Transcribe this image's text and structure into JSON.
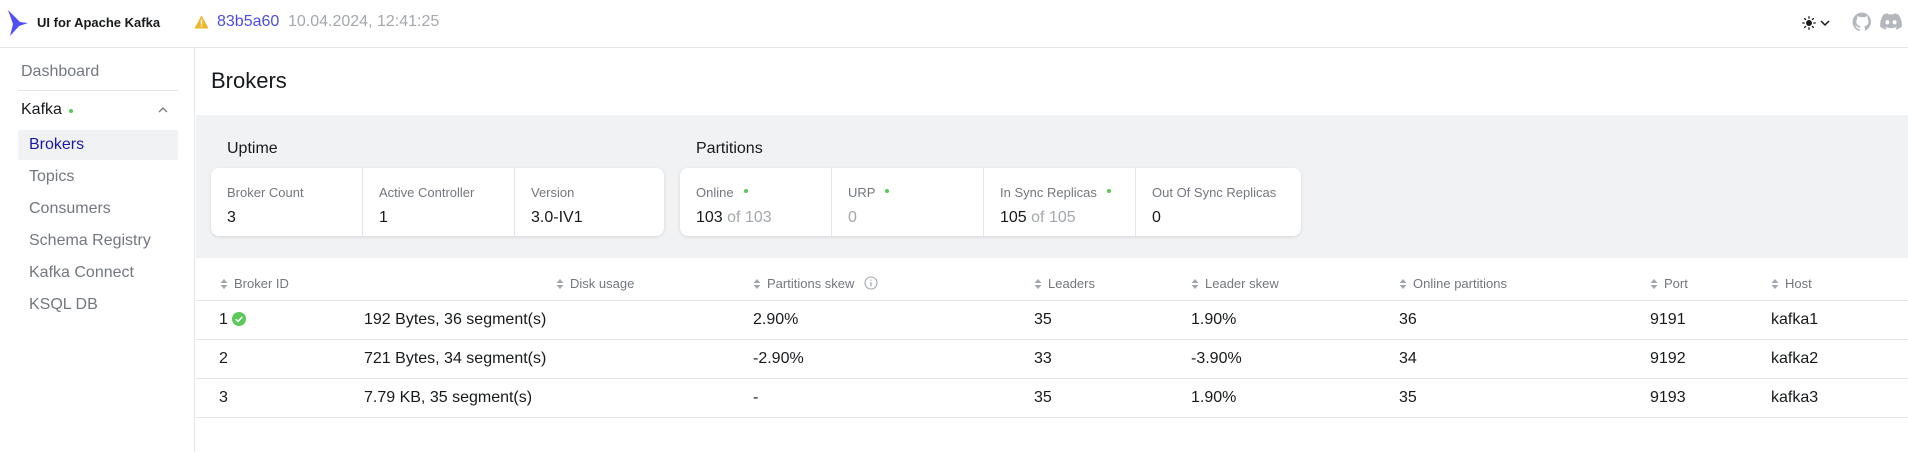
{
  "navbar": {
    "title": "UI for Apache Kafka",
    "version_hash": "83b5a60",
    "version_date": "10.04.2024, 12:41:25",
    "icons": [
      "kafka-logo",
      "warning-icon",
      "sun-icon",
      "chevron-down-icon",
      "github-icon",
      "discord-icon"
    ]
  },
  "sidebar": {
    "dashboard": "Dashboard",
    "cluster": {
      "name": "Kafka",
      "status_color": "#5ac95a"
    },
    "items": [
      {
        "label": "Brokers",
        "active": true
      },
      {
        "label": "Topics",
        "active": false
      },
      {
        "label": "Consumers",
        "active": false
      },
      {
        "label": "Schema Registry",
        "active": false
      },
      {
        "label": "Kafka Connect",
        "active": false
      },
      {
        "label": "KSQL DB",
        "active": false
      }
    ]
  },
  "page": {
    "title": "Brokers"
  },
  "uptime": {
    "label": "Uptime",
    "cards": [
      {
        "label": "Broker Count",
        "value": "3"
      },
      {
        "label": "Active Controller",
        "value": "1"
      },
      {
        "label": "Version",
        "value": "3.0-IV1"
      }
    ]
  },
  "partitions": {
    "label": "Partitions",
    "cards": [
      {
        "label": "Online",
        "value": "103",
        "of": "of 103"
      },
      {
        "label": "URP",
        "value": "0"
      },
      {
        "label": "In Sync Replicas",
        "value": "105",
        "of": "of 105"
      },
      {
        "label": "Out Of Sync Replicas",
        "value": "0"
      }
    ]
  },
  "table": {
    "columns": [
      "Broker ID",
      "Disk usage",
      "Partitions skew",
      "Leaders",
      "Leader skew",
      "Online partitions",
      "Port",
      "Host"
    ],
    "rows": [
      {
        "broker_id": "1",
        "disk_usage": "192 Bytes, 36 segment(s)",
        "partitions_skew": "2.90%",
        "leaders": "35",
        "leader_skew": "1.90%",
        "online_partitions": "36",
        "port": "9191",
        "host": "kafka1"
      },
      {
        "broker_id": "2",
        "disk_usage": "721 Bytes, 34 segment(s)",
        "partitions_skew": "-2.90%",
        "leaders": "33",
        "leader_skew": "-3.90%",
        "online_partitions": "34",
        "port": "9192",
        "host": "kafka2"
      },
      {
        "broker_id": "3",
        "disk_usage": "7.79 KB, 35 segment(s)",
        "partitions_skew": "-",
        "leaders": "35",
        "leader_skew": "1.90%",
        "online_partitions": "35",
        "port": "9193",
        "host": "kafka3"
      }
    ]
  },
  "colors": {
    "accent": "#4c4ce5",
    "active_nav": "#1a1aa8",
    "status_ok": "#5ac95a",
    "warning": "#f0b429"
  }
}
